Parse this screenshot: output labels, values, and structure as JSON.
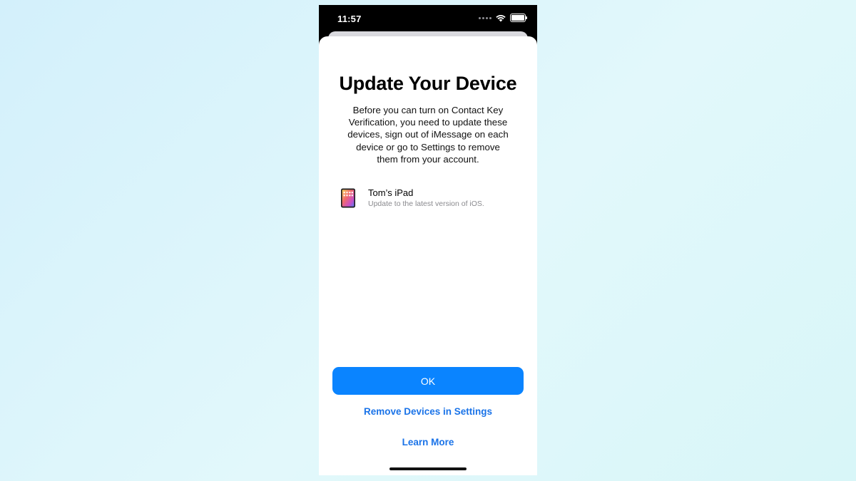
{
  "status_bar": {
    "time": "11:57",
    "icons": [
      "signal-dots-icon",
      "wifi-icon",
      "battery-icon"
    ]
  },
  "sheet": {
    "title": "Update Your Device",
    "body": "Before you can turn on Contact Key Verification, you need to update these devices, sign out of iMessage on each device or go to Settings to remove them from your account.",
    "devices": [
      {
        "icon": "ipad-icon",
        "name": "Tom’s iPad",
        "subtitle": "Update to the latest version of iOS."
      }
    ],
    "ok_label": "OK",
    "remove_label": "Remove Devices in Settings",
    "learn_more_label": "Learn More"
  },
  "colors": {
    "accent": "#0a84ff",
    "link": "#1a73e8",
    "background_start": "#d3f0fb",
    "background_end": "#d8f6f8"
  }
}
